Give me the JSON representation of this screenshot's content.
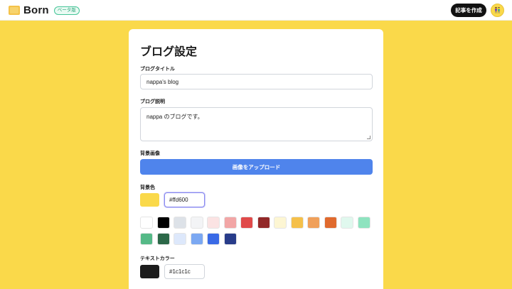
{
  "header": {
    "logo_text": "Born",
    "beta_badge": "ベータ版",
    "write_button": "記事を作成",
    "avatar_glyph": "👫"
  },
  "settings": {
    "title": "ブログ設定",
    "blog_title_label": "ブログタイトル",
    "blog_title_value": "nappa's blog",
    "blog_desc_label": "ブログ説明",
    "blog_desc_value": "nappa のブログです。",
    "bg_image_label": "背景画像",
    "upload_button": "画像をアップロード",
    "bg_color_label": "背景色",
    "bg_color_value": "#ffd600",
    "bg_color_preview": "#fad94a",
    "swatches": [
      "#ffffff",
      "#000000",
      "#dde2e8",
      "#f3f4f6",
      "#fbe3e3",
      "#f2a6a6",
      "#e04a4a",
      "#922828",
      "#fdf6d3",
      "#f5c04a",
      "#f0a05a",
      "#e06a2e",
      "#e0f8ee",
      "#8ee3bf",
      "#55b987",
      "#2c6848",
      "#dde8fb",
      "#7ba8f2",
      "#3a6ae6",
      "#283c8a"
    ],
    "text_color_label": "テキストカラー",
    "text_color_value": "#1c1c1c",
    "text_color_preview": "#1c1c1c"
  }
}
